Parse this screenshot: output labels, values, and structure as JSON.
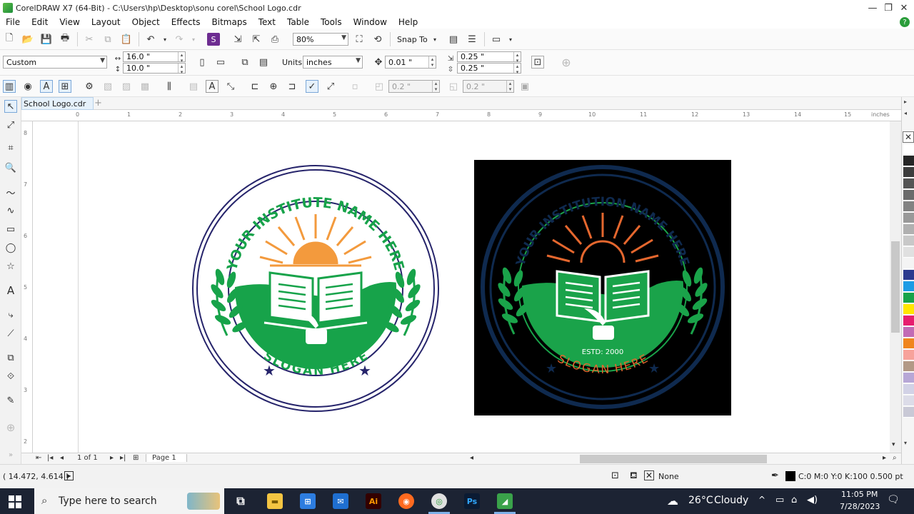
{
  "window": {
    "title": "CorelDRAW X7 (64-Bit) - C:\\Users\\hp\\Desktop\\sonu corel\\School Logo.cdr",
    "controls": [
      "—",
      "❐",
      "✕"
    ]
  },
  "menu": [
    "File",
    "Edit",
    "View",
    "Layout",
    "Object",
    "Effects",
    "Bitmaps",
    "Text",
    "Table",
    "Tools",
    "Window",
    "Help"
  ],
  "toolbar": {
    "zoom_value": "80%",
    "snap_to_label": "Snap To"
  },
  "property_bar": {
    "page_preset": "Custom",
    "width": "16.0 \"",
    "height": "10.0 \"",
    "units_label": "Units:",
    "units_value": "inches",
    "nudge": "0.01 \"",
    "dup_x": "0.25 \"",
    "dup_y": "0.25 \""
  },
  "third_bar": {
    "value_a": "0.2 \"",
    "value_b": "0.2 \""
  },
  "document_tab": "School Logo.cdr",
  "ruler": {
    "unit_label": "inches",
    "h_ticks": [
      "0",
      "1",
      "2",
      "3",
      "4",
      "5",
      "6",
      "7",
      "8",
      "9",
      "10",
      "11",
      "12",
      "13",
      "14",
      "15"
    ],
    "v_ticks": [
      "8",
      "7",
      "6",
      "5",
      "4",
      "3",
      "2"
    ]
  },
  "logo_light": {
    "top_text": "YOUR INSTITUTE NAME HERE",
    "bottom_text": "SLOGAN HERE",
    "colors": {
      "ring": "#26246b",
      "green": "#17a34a",
      "sun": "#f39a3d"
    }
  },
  "logo_dark": {
    "top_text": "YOUR INSTITUTION NAME HERE",
    "bottom_text": "SLOGAN HERE",
    "estd": "ESTD: 2000",
    "colors": {
      "ring": "#0f2a4f",
      "green": "#1aa34a",
      "sun": "#e5672e",
      "bg": "#000000"
    }
  },
  "page_nav": {
    "count_label": "1 of 1",
    "page_tab": "Page 1"
  },
  "status": {
    "cursor_coords": "( 14.472, 4.614 )",
    "fill_label": "None",
    "outline_label": "C:0 M:0 Y:0 K:100  0.500 pt"
  },
  "palette": [
    "#ffffff",
    "#262626",
    "#3d3d3d",
    "#555555",
    "#6b6b6b",
    "#828282",
    "#999999",
    "#b0b0b0",
    "#c8c8c8",
    "#e0e0e0",
    "#f4f4f4",
    "#2b3a8f",
    "#1d9ce5",
    "#17a34a",
    "#ffe600",
    "#e61e6e",
    "#c26bb5",
    "#f0851e",
    "#f7a29b",
    "#b29986",
    "#b7a7d6",
    "#d2d2e6",
    "#dcdce8",
    "#c9c9d6"
  ],
  "taskbar": {
    "search_placeholder": "Type here to search",
    "weather_temp": "26°C",
    "weather_desc": "Cloudy",
    "time": "11:05 PM",
    "date": "7/28/2023",
    "apps": [
      "task-view",
      "file-explorer",
      "store",
      "mail",
      "illustrator",
      "firefox",
      "chrome",
      "photoshop",
      "coreldraw"
    ]
  }
}
